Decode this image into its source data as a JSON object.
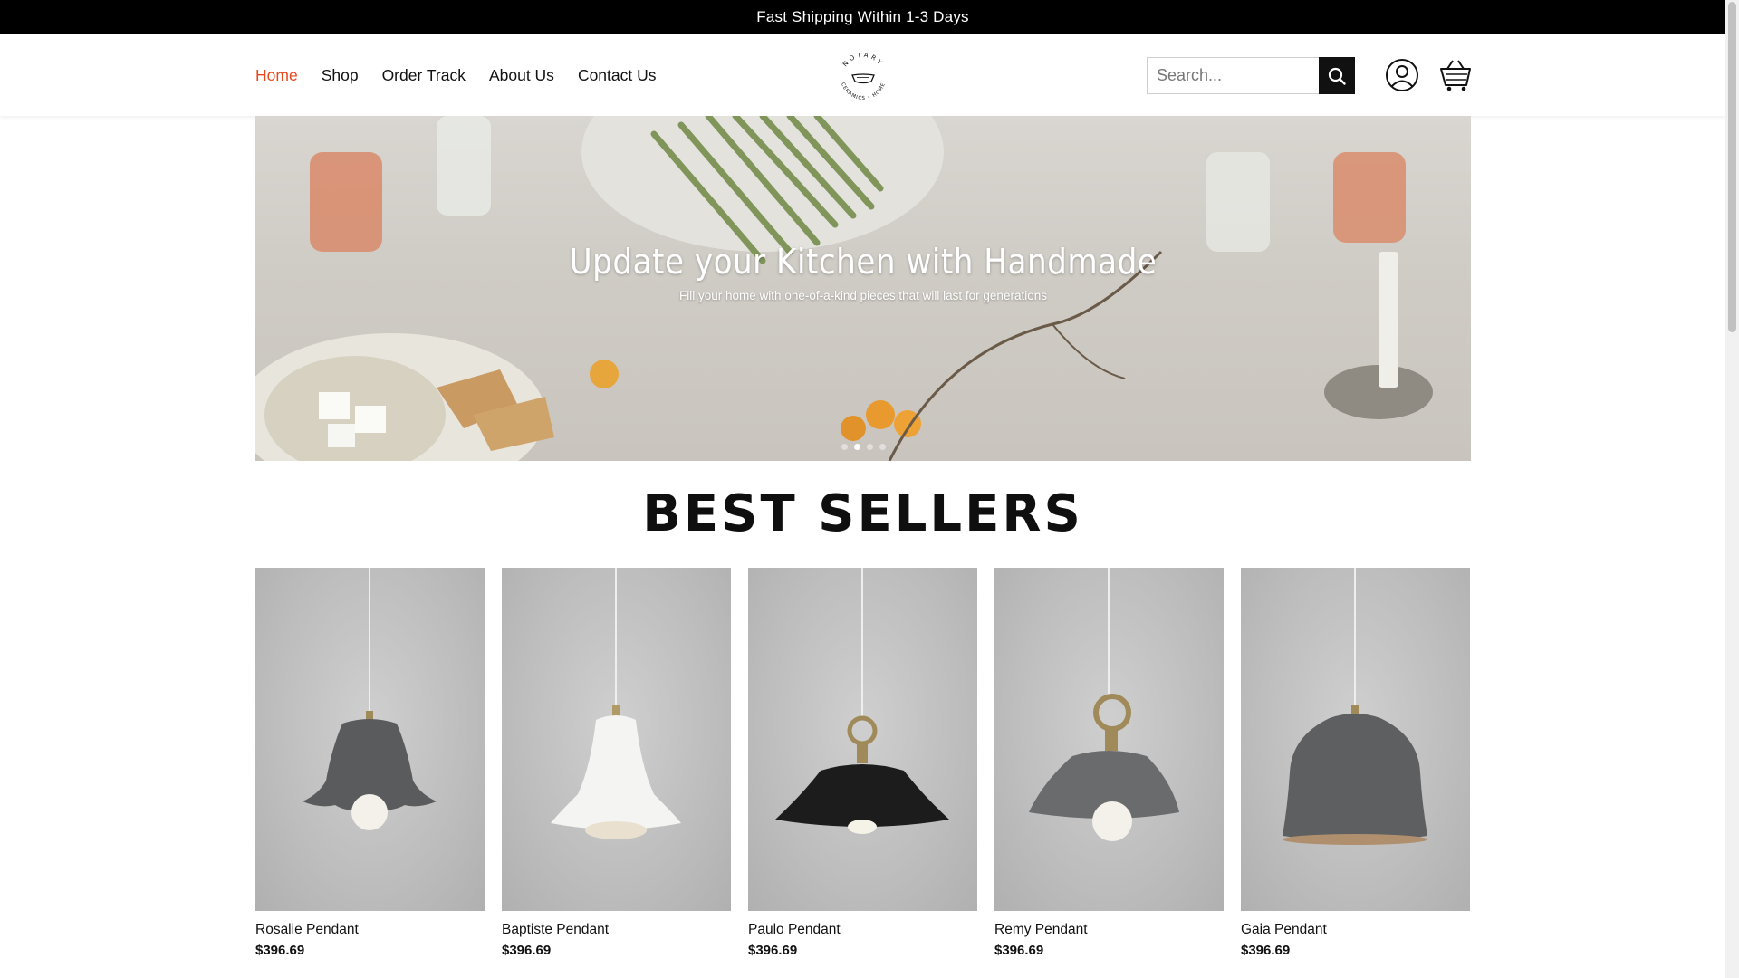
{
  "announcement": "Fast Shipping Within 1-3 Days",
  "nav": {
    "items": [
      {
        "label": "Home",
        "active": true
      },
      {
        "label": "Shop",
        "active": false
      },
      {
        "label": "Order Track",
        "active": false
      },
      {
        "label": "About Us",
        "active": false
      },
      {
        "label": "Contact Us",
        "active": false
      }
    ]
  },
  "logo": {
    "top_text": "NOTARY",
    "bottom_text": "CERAMICS • HOME"
  },
  "search": {
    "placeholder": "Search..."
  },
  "icons": {
    "search": "search-icon",
    "account": "user-icon",
    "cart": "cart-icon"
  },
  "hero": {
    "title": "Update your Kitchen with Handmade",
    "subtitle": "Fill your home with one-of-a-kind pieces that will last for generations",
    "slide_count": 4,
    "active_slide": 2
  },
  "best_sellers": {
    "title": "BEST SELLERS",
    "products": [
      {
        "name": "Rosalie Pendant",
        "price": "$396.69",
        "shade": "grey-scalloped"
      },
      {
        "name": "Baptiste Pendant",
        "price": "$396.69",
        "shade": "white-bell"
      },
      {
        "name": "Paulo Pendant",
        "price": "$396.69",
        "shade": "black-dome"
      },
      {
        "name": "Remy Pendant",
        "price": "$396.69",
        "shade": "grey-dome"
      },
      {
        "name": "Gaia Pendant",
        "price": "$396.69",
        "shade": "grey-bell"
      }
    ]
  },
  "colors": {
    "accent": "#e8491d",
    "topbar": "#000000"
  }
}
